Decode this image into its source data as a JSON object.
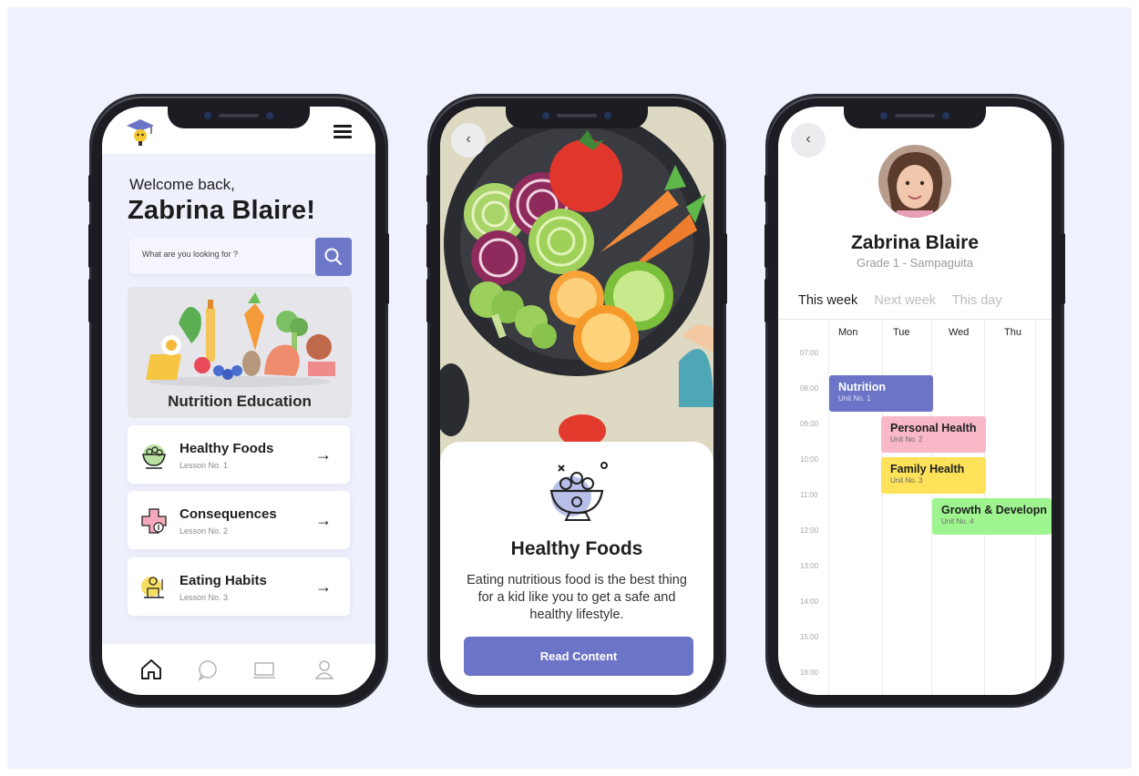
{
  "screen1": {
    "greeting": "Welcome back,",
    "user_name": "Zabrina Blaire!",
    "search_placeholder": "What are you looking for ?",
    "banner_title": "Nutrition Education",
    "lessons": [
      {
        "title": "Healthy Foods",
        "sub": "Lesson No. 1",
        "icon": "salad-bowl-icon"
      },
      {
        "title": "Consequences",
        "sub": "Lesson No. 2",
        "icon": "medical-cross-icon"
      },
      {
        "title": "Eating Habits",
        "sub": "Lesson No. 3",
        "icon": "eating-child-icon"
      }
    ],
    "bottom_nav": [
      "home-icon",
      "chat-icon",
      "laptop-icon",
      "profile-icon"
    ]
  },
  "screen2": {
    "title": "Healthy Foods",
    "description": "Eating nutritious food is the best thing for a kid like you to get a safe and healthy lifestyle.",
    "button": "Read Content"
  },
  "screen3": {
    "name": "Zabrina Blaire",
    "grade": "Grade 1 - Sampaguita",
    "tabs": [
      "This week",
      "Next week",
      "This day"
    ],
    "active_tab": "This week",
    "days": [
      "Mon",
      "Tue",
      "Wed",
      "Thu"
    ],
    "times": [
      "07:00",
      "08:00",
      "09:00",
      "10:00",
      "11:00",
      "12:00",
      "13:00",
      "14:00",
      "15:00",
      "16:00"
    ],
    "events": [
      {
        "title": "Nutrition",
        "unit": "Unit No. 1",
        "color": "#6b74c6"
      },
      {
        "title": "Personal Health",
        "unit": "Unit No. 2",
        "color": "#f8b8c8"
      },
      {
        "title": "Family Health",
        "unit": "Unit No. 3",
        "color": "#fde25a"
      },
      {
        "title": "Growth & Developn",
        "unit": "Unit No. 4",
        "color": "#9ef58f"
      }
    ]
  },
  "colors": {
    "accent": "#6b74c6",
    "background": "#eff1fd"
  }
}
